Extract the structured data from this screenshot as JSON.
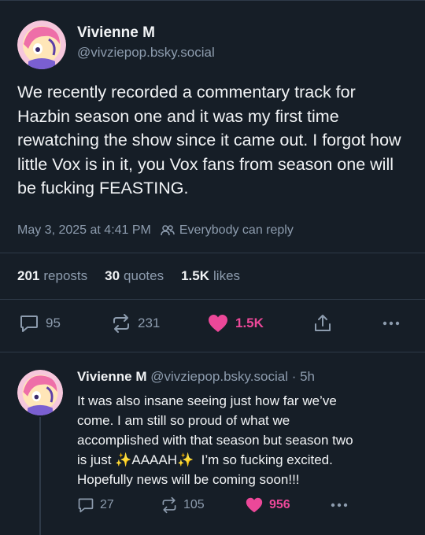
{
  "post": {
    "author_name": "Vivienne M",
    "author_handle": "@vivziepop.bsky.social",
    "text": "We recently recorded a commentary track for Hazbin season one and it was my first time rewatching the show since it came out. I forgot how little Vox is in it, you Vox fans from season one will be fucking FEASTING.",
    "timestamp": "May 3, 2025 at 4:41 PM",
    "reply_setting": "Everybody can reply",
    "stats": {
      "reposts_count": "201",
      "reposts_label": "reposts",
      "quotes_count": "30",
      "quotes_label": "quotes",
      "likes_count": "1.5K",
      "likes_label": "likes"
    },
    "actions": {
      "replies": "95",
      "reposts": "231",
      "likes": "1.5K"
    }
  },
  "reply": {
    "author_name": "Vivienne M",
    "author_handle": "@vivziepop.bsky.social",
    "age": "· 5h",
    "text_line1": "It was also insane seeing just how far we’ve",
    "text_line2": "come. I am still so proud of what we",
    "text_line3": "accomplished with that season but season two",
    "text_line4_pre": "is just ",
    "text_line4_mid": "AAAAH",
    "text_line4_post": "  I’m so fucking excited.",
    "text_line5": "Hopefully news will be coming soon!!!",
    "sparkle": "✨",
    "actions": {
      "replies": "27",
      "reposts": "105",
      "likes": "956"
    }
  },
  "colors": {
    "background": "#161e27",
    "muted": "#8d9cae",
    "like": "#ec4899",
    "divider": "#2e3a48"
  }
}
